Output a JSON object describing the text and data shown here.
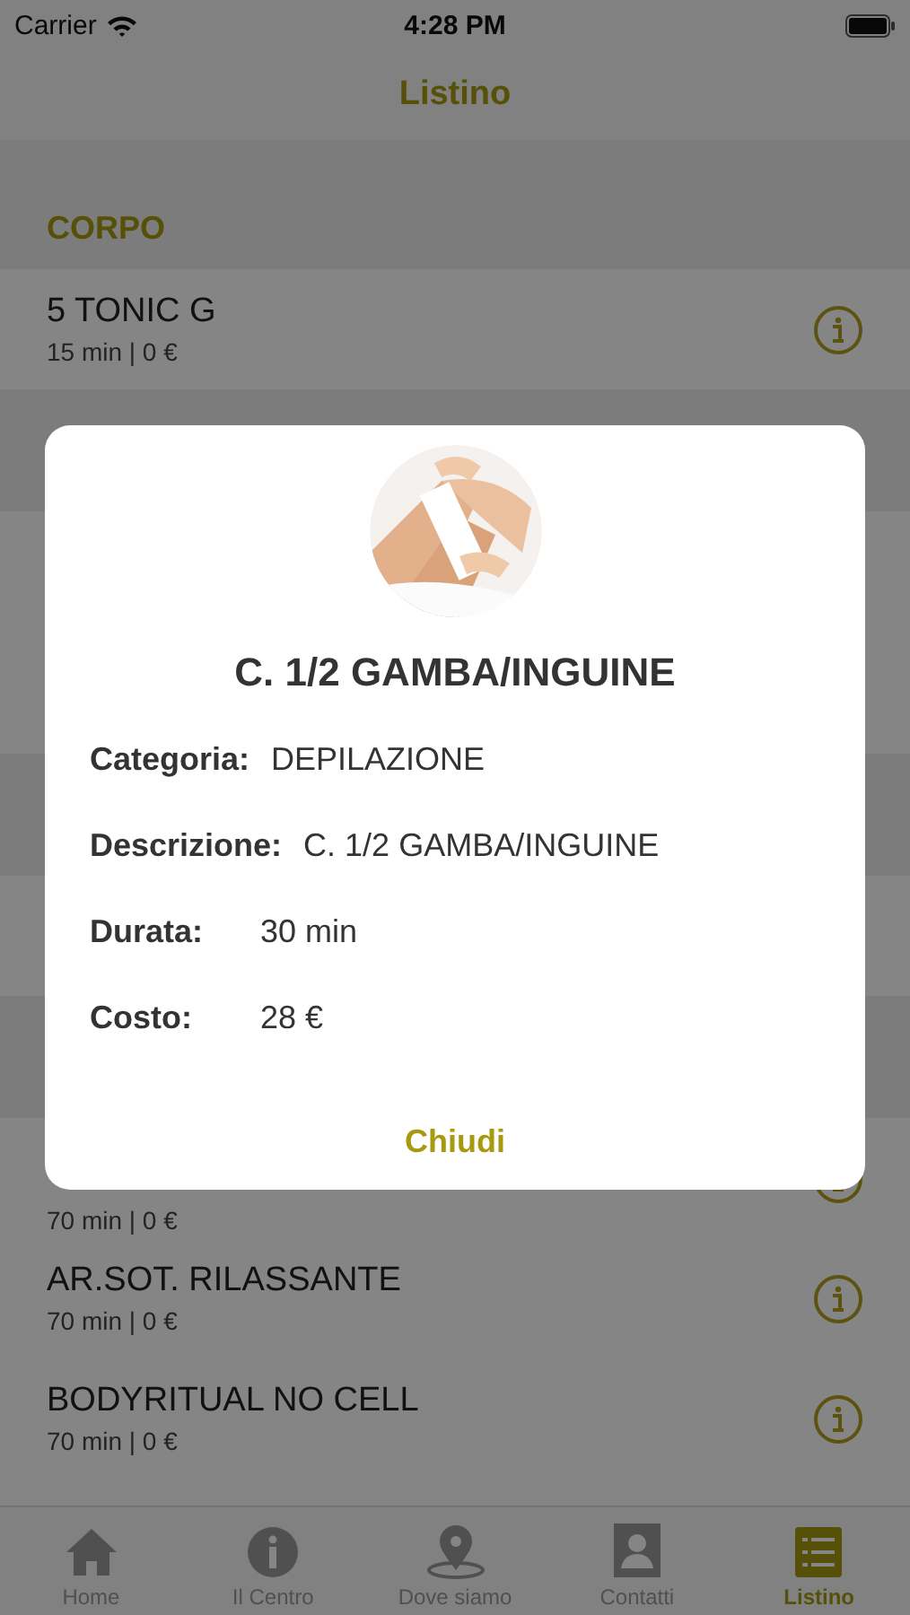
{
  "status_bar": {
    "carrier": "Carrier",
    "time": "4:28 PM"
  },
  "nav": {
    "title": "Listino"
  },
  "list": {
    "section": "CORPO",
    "items": [
      {
        "name": "5 TONIC G",
        "details": "15 min | 0 €"
      }
    ],
    "lower_items": [
      {
        "details": "70 min | 0 €"
      },
      {
        "name": "AR.SOT. RILASSANTE",
        "details": "70 min | 0 €"
      },
      {
        "name": "BODYRITUAL NO CELL",
        "details": "70 min | 0 €"
      }
    ]
  },
  "dialog": {
    "title": "C. 1/2 GAMBA/INGUINE",
    "fields": [
      {
        "label": "Categoria:",
        "value": "DEPILAZIONE"
      },
      {
        "label": "Descrizione:",
        "value": "C. 1/2 GAMBA/INGUINE"
      },
      {
        "label": "Durata:",
        "value": "30 min"
      },
      {
        "label": "Costo:",
        "value": "28 €"
      }
    ],
    "close_button": "Chiudi"
  },
  "tabs": [
    {
      "label": "Home",
      "kind": "home",
      "selected": false
    },
    {
      "label": "Il Centro",
      "kind": "info",
      "selected": false
    },
    {
      "label": "Dove siamo",
      "kind": "pin",
      "selected": false
    },
    {
      "label": "Contatti",
      "kind": "contact",
      "selected": false
    },
    {
      "label": "Listino",
      "kind": "list",
      "selected": true
    }
  ]
}
